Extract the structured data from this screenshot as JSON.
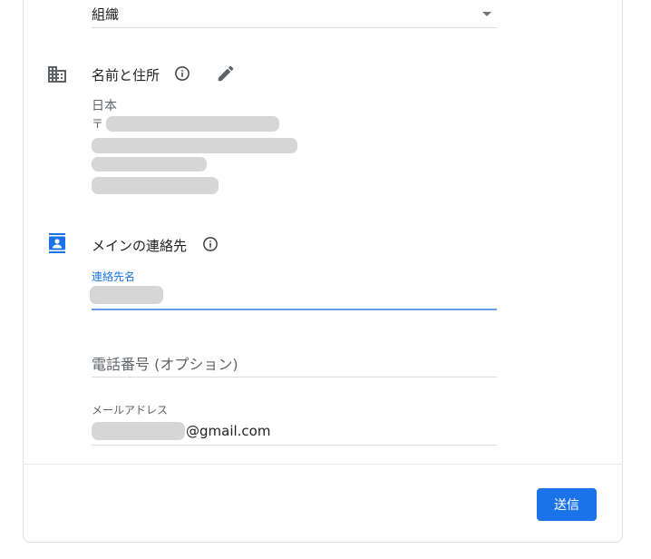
{
  "organization": {
    "selected_value": "組織"
  },
  "name_address": {
    "title": "名前と住所",
    "icon": "building-icon",
    "country": "日本",
    "postal_prefix": "〒"
  },
  "main_contact": {
    "title": "メインの連絡先",
    "icon": "contact-card-icon",
    "contact_name": {
      "label": "連絡先名"
    },
    "phone": {
      "placeholder": "電話番号 (オプション)"
    },
    "email": {
      "label": "メールアドレス",
      "domain_suffix": "@gmail.com"
    }
  },
  "actions": {
    "submit_label": "送信"
  },
  "colors": {
    "accent": "#1a73e8",
    "icon_blue": "#1a73e8",
    "icon_gray": "#5f6368"
  }
}
